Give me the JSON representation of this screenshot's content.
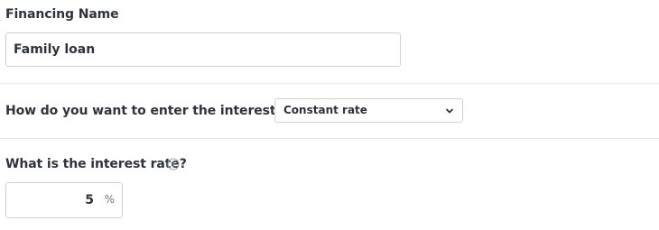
{
  "financing": {
    "label": "Financing Name",
    "value": "Family loan"
  },
  "rate_entry": {
    "question": "How do you want to enter the interest rate?",
    "selected": "Constant rate"
  },
  "interest_rate": {
    "label": "What is the interest rate?",
    "value": "5",
    "unit": "%"
  },
  "icons": {
    "info": "info-icon",
    "dropdown": "chevron-down-icon"
  },
  "colors": {
    "text": "#2f333d",
    "border": "#cfd3d9",
    "divider": "#e6e8eb"
  }
}
